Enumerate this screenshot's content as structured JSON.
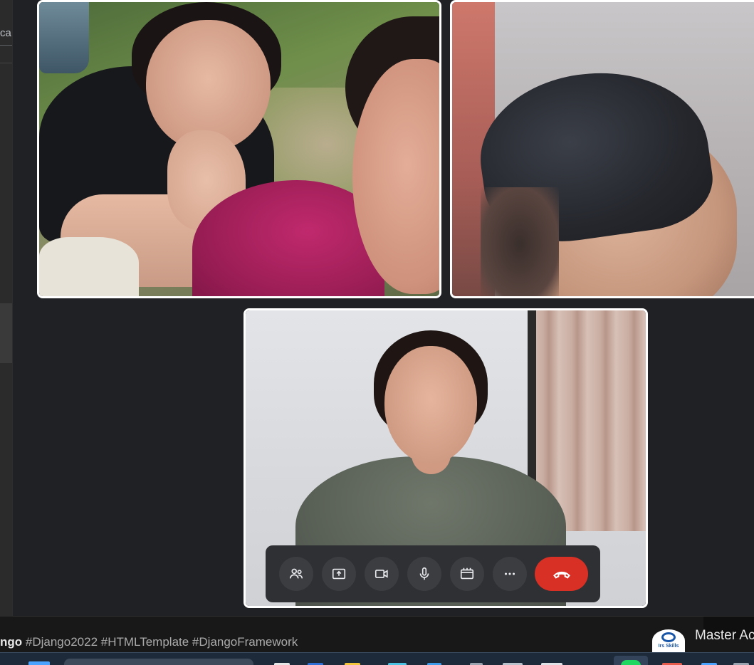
{
  "background_page": {
    "left_field_text": "ca",
    "hashtags": {
      "first": "ngo",
      "rest": "#Django2022 #HTMLTemplate #DjangoFramework"
    },
    "video_title": "Master Ac",
    "channel_logo_text": "Irs Skills"
  },
  "call": {
    "participants": [
      {
        "tile": "participant-tile-1",
        "scene": "two-girls-outdoor"
      },
      {
        "tile": "participant-tile-2",
        "scene": "man-selfie"
      },
      {
        "tile": "participant-tile-3",
        "scene": "woman-room"
      }
    ],
    "controls": [
      {
        "name": "people-button",
        "icon": "people-icon"
      },
      {
        "name": "present-screen-button",
        "icon": "present-icon"
      },
      {
        "name": "camera-button",
        "icon": "camera-icon"
      },
      {
        "name": "microphone-button",
        "icon": "microphone-icon"
      },
      {
        "name": "effects-button",
        "icon": "effects-icon"
      },
      {
        "name": "more-options-button",
        "icon": "more-icon"
      },
      {
        "name": "end-call-button",
        "icon": "hang-up-icon",
        "color": "#d93025"
      }
    ],
    "colors": {
      "tile_border": "#ffffff",
      "control_bar": "#2f3033",
      "control_button": "#3c3d40",
      "end_call": "#d93025",
      "window_bg": "#202124"
    }
  },
  "taskbar": {
    "items": [
      "start-icon",
      "search-box",
      "file-explorer-icon",
      "browser-icon",
      "folder-icon",
      "edge-icon",
      "store-icon",
      "app-icon",
      "mail-icon",
      "chrome-icon",
      "spotify-icon",
      "app-icon-red",
      "app-icon-blue",
      "app-icon-gray"
    ]
  }
}
